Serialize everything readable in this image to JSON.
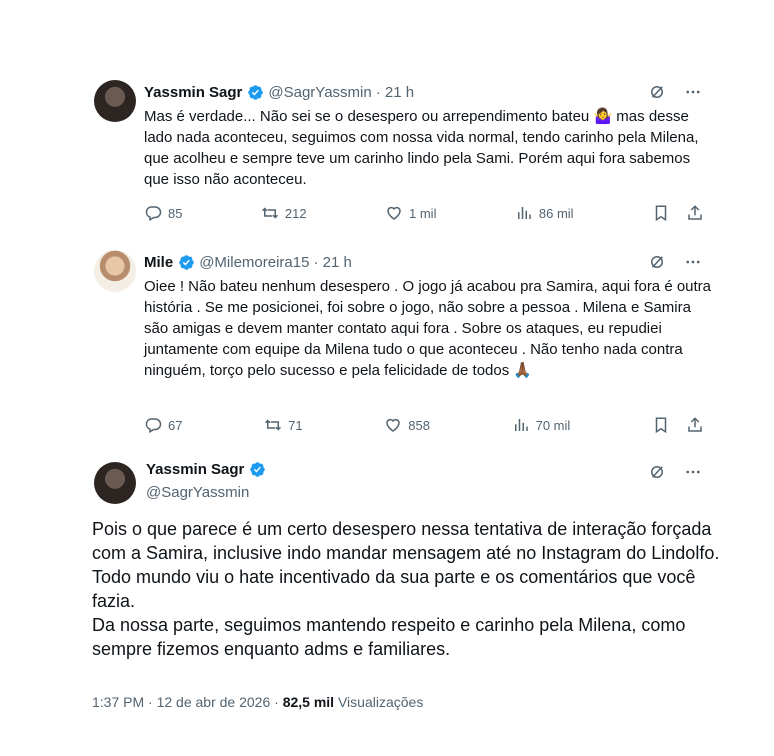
{
  "reply1": {
    "name": "Yassmin Sagr",
    "handle": "@SagrYassmin",
    "time": "· 21 h",
    "text_before_emoji": "Mas é verdade... Não sei se o desespero ou arrependimento bateu ",
    "emoji": "🤷‍♀️",
    "text_after_emoji": " mas desse lado nada aconteceu, seguimos com nossa vida normal, tendo carinho pela Milena, que acolheu e sempre teve um carinho lindo pela Sami. Porém aqui fora sabemos que isso não aconteceu.",
    "replies": "85",
    "retweets": "212",
    "likes": "1 mil",
    "views": "86 mil"
  },
  "reply2": {
    "name": "Mile",
    "handle": "@Milemoreira15",
    "time": "· 21 h",
    "text": "Oiee ! Não bateu nenhum desespero . O jogo já acabou pra Samira, aqui fora é outra história . Se me posicionei, foi sobre o jogo, não sobre a pessoa . Milena e Samira são amigas e devem manter contato aqui fora . Sobre os ataques, eu repudiei juntamente com equipe da Milena tudo o que aconteceu . Não tenho nada contra ninguém, torço pelo sucesso e pela felicidade de todos",
    "emoji": "🙏🏾",
    "replies": "67",
    "retweets": "71",
    "likes": "858",
    "views": "70 mil"
  },
  "main": {
    "name": "Yassmin Sagr",
    "handle": "@SagrYassmin",
    "text": "Pois o que parece é um certo desespero nessa tentativa de interação forçada com a Samira, inclusive indo mandar mensagem até no Instagram do Lindolfo. Todo mundo viu o hate incentivado da sua parte e os comentários que você fazia.\nDa nossa parte, seguimos mantendo respeito e carinho pela Milena, como sempre fizemos enquanto adms e familiares.",
    "time": "1:37 PM",
    "date": "12 de abr de 2026",
    "views_count": "82,5 mil",
    "views_label": "Visualizações"
  },
  "colors": {
    "verified": "#1d9bf0",
    "muted": "#536471",
    "text": "#0f1419"
  },
  "icons": [
    "verified-badge-icon",
    "grok-icon",
    "more-icon",
    "reply-icon",
    "retweet-icon",
    "like-icon",
    "views-icon",
    "bookmark-icon",
    "share-icon"
  ]
}
